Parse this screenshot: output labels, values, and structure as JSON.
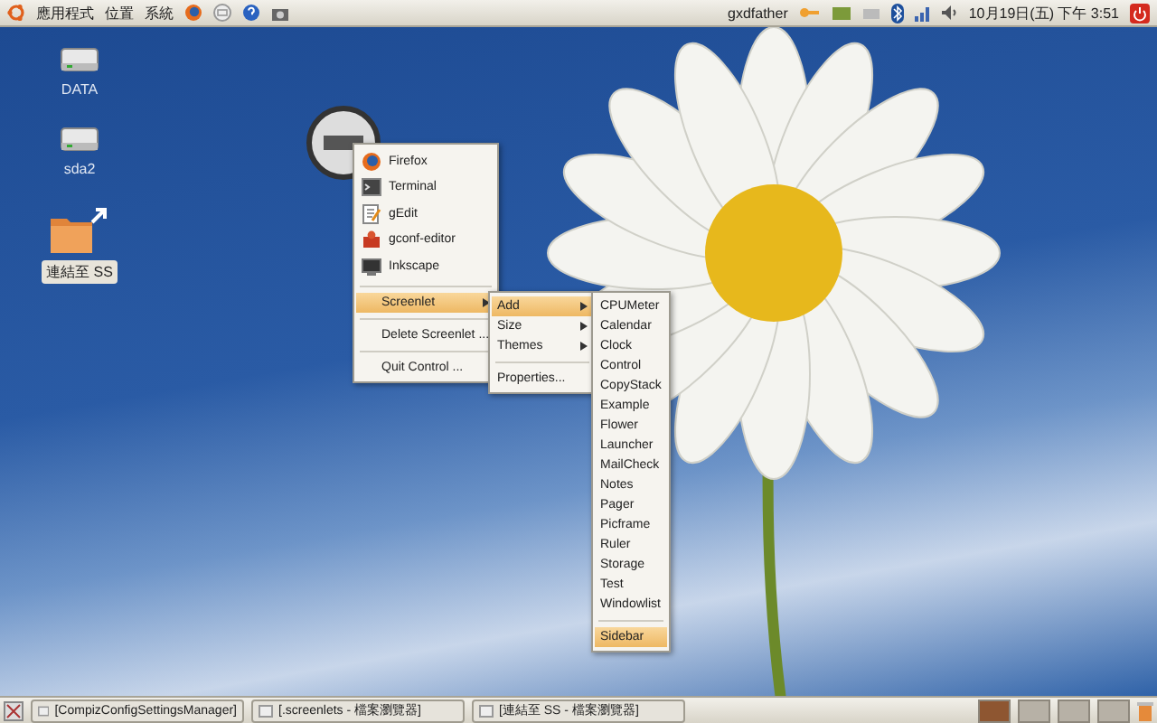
{
  "top_panel": {
    "menus": [
      "應用程式",
      "位置",
      "系統"
    ],
    "user": "gxdfather",
    "clock": "10月19日(五) 下午 3:51"
  },
  "desktop_icons": [
    {
      "kind": "drive",
      "label": "DATA",
      "selected": false
    },
    {
      "kind": "drive",
      "label": "sda2",
      "selected": false
    },
    {
      "kind": "link",
      "label": "連結至 SS",
      "selected": true
    }
  ],
  "control_menu": [
    {
      "kind": "app",
      "label": "Firefox"
    },
    {
      "kind": "app",
      "label": "Terminal"
    },
    {
      "kind": "app",
      "label": "gEdit"
    },
    {
      "kind": "app",
      "label": "gconf-editor"
    },
    {
      "kind": "app",
      "label": "Inkscape"
    },
    {
      "kind": "separator"
    },
    {
      "kind": "submenu",
      "label": "Screenlet",
      "selected": true
    },
    {
      "kind": "separator"
    },
    {
      "kind": "item",
      "label": "Delete Screenlet ...",
      "selected": false
    },
    {
      "kind": "separator"
    },
    {
      "kind": "item",
      "label": "Quit Control ...",
      "selected": false
    }
  ],
  "screenlet_menu": [
    {
      "kind": "submenu",
      "label": "Add",
      "selected": true
    },
    {
      "kind": "submenu",
      "label": "Size",
      "selected": false
    },
    {
      "kind": "submenu",
      "label": "Themes",
      "selected": false
    },
    {
      "kind": "separator"
    },
    {
      "kind": "item",
      "label": "Properties...",
      "selected": false
    }
  ],
  "add_menu": [
    {
      "kind": "item",
      "label": "CPUMeter",
      "selected": false
    },
    {
      "kind": "item",
      "label": "Calendar",
      "selected": false
    },
    {
      "kind": "item",
      "label": "Clock",
      "selected": false
    },
    {
      "kind": "item",
      "label": "Control",
      "selected": false
    },
    {
      "kind": "item",
      "label": "CopyStack",
      "selected": false
    },
    {
      "kind": "item",
      "label": "Example",
      "selected": false
    },
    {
      "kind": "item",
      "label": "Flower",
      "selected": false
    },
    {
      "kind": "item",
      "label": "Launcher",
      "selected": false
    },
    {
      "kind": "item",
      "label": "MailCheck",
      "selected": false
    },
    {
      "kind": "item",
      "label": "Notes",
      "selected": false
    },
    {
      "kind": "item",
      "label": "Pager",
      "selected": false
    },
    {
      "kind": "item",
      "label": "Picframe",
      "selected": false
    },
    {
      "kind": "item",
      "label": "Ruler",
      "selected": false
    },
    {
      "kind": "item",
      "label": "Storage",
      "selected": false
    },
    {
      "kind": "item",
      "label": "Test",
      "selected": false
    },
    {
      "kind": "item",
      "label": "Windowlist",
      "selected": false
    },
    {
      "kind": "separator"
    },
    {
      "kind": "item",
      "label": "Sidebar",
      "selected": true
    }
  ],
  "taskbar": {
    "tasks": [
      {
        "label": "[CompizConfigSettingsManager]",
        "selected": false
      },
      {
        "label": "[.screenlets - 檔案瀏覽器]",
        "selected": false
      },
      {
        "label": "[連結至 SS - 檔案瀏覽器]",
        "selected": false
      }
    ],
    "workspaces": [
      {
        "selected": true
      },
      {
        "selected": false
      },
      {
        "selected": false
      },
      {
        "selected": false
      }
    ]
  }
}
